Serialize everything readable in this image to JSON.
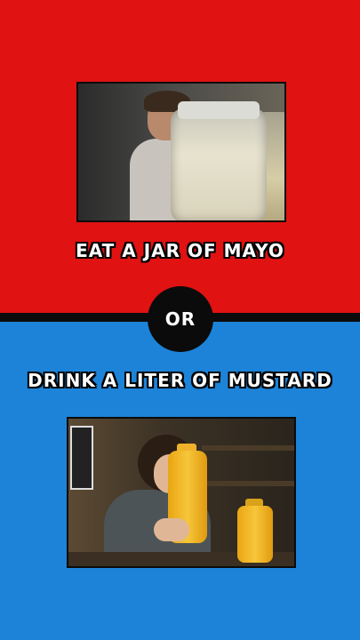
{
  "option_top": {
    "caption": "EAT A JAR OF MAYO",
    "color": "#e01212"
  },
  "divider": {
    "label": "OR"
  },
  "option_bottom": {
    "caption": "DRINK A LITER OF MUSTARD",
    "color": "#1c83d8"
  }
}
